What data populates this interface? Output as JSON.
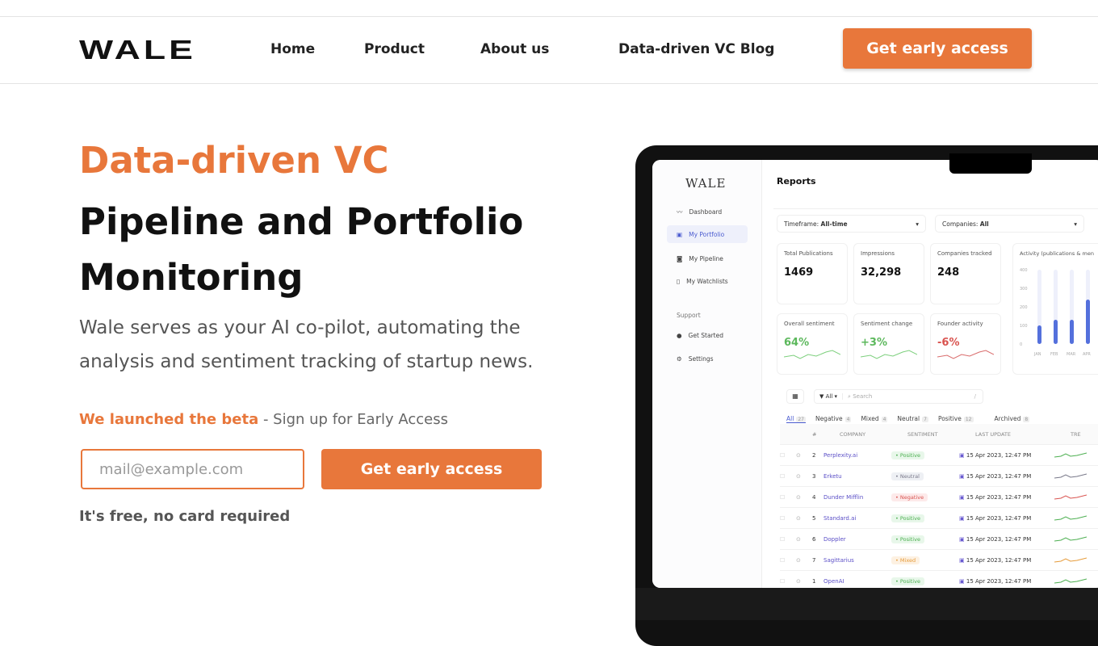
{
  "nav": {
    "logo": "WALE",
    "items": [
      "Home",
      "Product",
      "About us",
      "Data-driven VC Blog"
    ],
    "cta": "Get early access"
  },
  "hero": {
    "eyebrow": "Data-driven VC",
    "title": "Pipeline and Portfolio Monitoring",
    "subtitle": "Wale serves as your AI co-pilot, automating the analysis and sentiment tracking of startup news.",
    "beta_highlight": "We launched the beta",
    "beta_rest": " - Sign up for Early Access",
    "email_placeholder": "mail@example.com",
    "cta": "Get early access",
    "note": "It's free, no card required"
  },
  "app": {
    "logo": "WALE",
    "page_title": "Reports",
    "sidebar": [
      "Dashboard",
      "My Portfolio",
      "My Pipeline",
      "My Watchlists"
    ],
    "support_label": "Support",
    "support": [
      "Get Started",
      "Settings"
    ],
    "filters": {
      "timeframe_label": "Timeframe:",
      "timeframe": "All-time",
      "companies_label": "Companies:",
      "companies": "All"
    },
    "stats": [
      {
        "label": "Total Publications",
        "value": "1469"
      },
      {
        "label": "Impressions",
        "value": "32,298"
      },
      {
        "label": "Companies tracked",
        "value": "248"
      }
    ],
    "sentiment": [
      {
        "label": "Overall sentiment",
        "value": "64%",
        "color": "#5cb85c"
      },
      {
        "label": "Sentiment change",
        "value": "+3%",
        "color": "#5cb85c"
      },
      {
        "label": "Founder activity",
        "value": "-6%",
        "color": "#d9534f"
      }
    ],
    "activity": {
      "title": "Activity (publications & men",
      "yticks": [
        "400",
        "300",
        "200",
        "100",
        "0"
      ],
      "months": [
        "JAN",
        "FEB",
        "MAR",
        "APR"
      ],
      "values": [
        100,
        130,
        130,
        240
      ]
    },
    "toolbar": {
      "filter": "All",
      "search_placeholder": "Search",
      "shortcut": "/"
    },
    "tabs": [
      {
        "label": "All",
        "count": "27"
      },
      {
        "label": "Negative",
        "count": "4"
      },
      {
        "label": "Mixed",
        "count": "4"
      },
      {
        "label": "Neutral",
        "count": "7"
      },
      {
        "label": "Positive",
        "count": "12"
      },
      {
        "label": "Archived",
        "count": "8"
      }
    ],
    "columns": [
      "#",
      "COMPANY",
      "SENTIMENT",
      "LAST UPDATE",
      "TRE"
    ],
    "rows": [
      {
        "n": "2",
        "company": "Perplexity.ai",
        "sentiment": "Positive",
        "date": "15 Apr 2023, 12:47 PM"
      },
      {
        "n": "3",
        "company": "Erketu",
        "sentiment": "Neutral",
        "date": "15 Apr 2023, 12:47 PM"
      },
      {
        "n": "4",
        "company": "Dunder Mifflin",
        "sentiment": "Negative",
        "date": "15 Apr 2023, 12:47 PM"
      },
      {
        "n": "5",
        "company": "Standard.ai",
        "sentiment": "Positive",
        "date": "15 Apr 2023, 12:47 PM"
      },
      {
        "n": "6",
        "company": "Doppler",
        "sentiment": "Positive",
        "date": "15 Apr 2023, 12:47 PM"
      },
      {
        "n": "7",
        "company": "Sagittarius",
        "sentiment": "Mixed",
        "date": "15 Apr 2023, 12:47 PM"
      },
      {
        "n": "1",
        "company": "OpenAI",
        "sentiment": "Positive",
        "date": "15 Apr 2023, 12:47 PM"
      }
    ]
  },
  "colors": {
    "accent": "#e8773b"
  }
}
